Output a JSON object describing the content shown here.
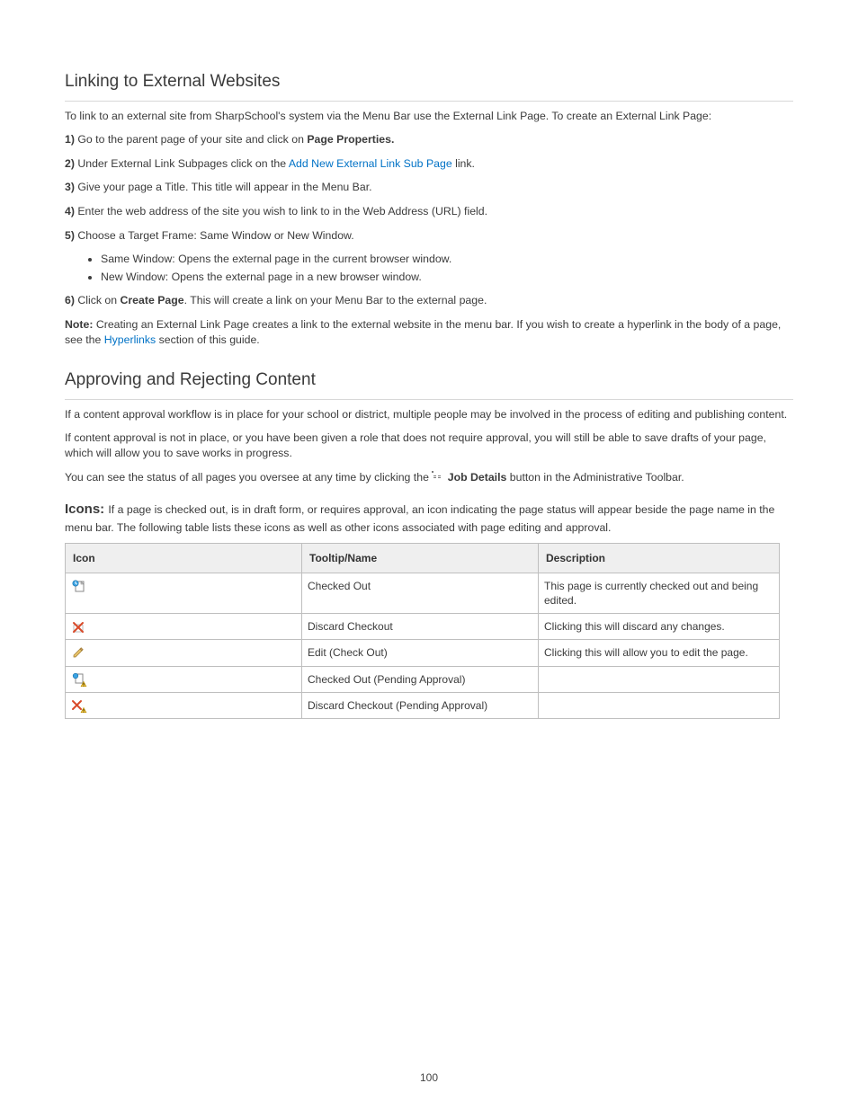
{
  "sections": {
    "linking": {
      "title": "Linking to External Websites",
      "intro": "To link to an external site from SharpSchool's system via the Menu Bar use the External Link Page. To create an External Link Page:",
      "step1_a": "Go to the parent page of your site and click on ",
      "step1_b": "Page Properties.",
      "step2_a": "Under External Link Subpages click on the ",
      "step2_b": "Add New External Link Sub Page",
      "step2_c": " link.",
      "item3": "Give your page a Title. This title will appear in the Menu Bar.",
      "item4": "Enter the web address of the site you wish to link to in the Web Address (URL) field.",
      "item5": "Choose a Target Frame: Same Window or New Window.",
      "bullets": {
        "b1": "Same Window: Opens the external page in the current browser window.",
        "b2": "New Window: Opens the external page in a new browser window."
      },
      "step6_a": "Click on ",
      "step6_b": "Create Page",
      "step6_c": ". This will create a link on your Menu Bar to the external page.",
      "note_label": "Note:",
      "note_text": " Creating an External Link Page creates a link to the external website in the menu bar. If you wish to create a hyperlink in the body of a page, see the ",
      "note_link": "Hyperlinks",
      "note_text2": " section of this guide."
    },
    "approval": {
      "title": "Approving and Rejecting Content",
      "para1": "If a content approval workflow is in place for your school or district, multiple people may be involved in the process of editing and publishing content.",
      "para2": "If content approval is not in place, or you have been given a role that does not require approval, you will still be able to save drafts of your page, which will allow you to save works in progress.",
      "para3_a": "You can see the status of all pages you oversee at any time by clicking the ",
      "para3_b": "Job Details",
      "para3_c": " button in the Administrative Toolbar.",
      "para4_lead": "Icons: ",
      "para4": "If a page is checked out, is in draft form, or requires approval, an icon indicating the page status will appear beside the page name in the menu bar. The following table lists these icons as well as other icons associated with page editing and approval.",
      "table": {
        "headers": [
          "Icon",
          "Tooltip/Name",
          "Description"
        ],
        "rows": [
          {
            "icon": "checkout",
            "name": "Checked Out",
            "desc": "This page is currently checked out and being edited."
          },
          {
            "icon": "discard",
            "name": "Discard Checkout",
            "desc": "Clicking this will discard any changes."
          },
          {
            "icon": "edit",
            "name": "Edit (Check Out)",
            "desc": "Clicking this will allow you to edit the page."
          },
          {
            "icon": "checkout-pending",
            "name": "Checked Out (Pending Approval)",
            "desc": ""
          },
          {
            "icon": "discard-pending",
            "name": "Discard Checkout (Pending Approval)",
            "desc": ""
          }
        ]
      }
    }
  },
  "page_number": "100"
}
